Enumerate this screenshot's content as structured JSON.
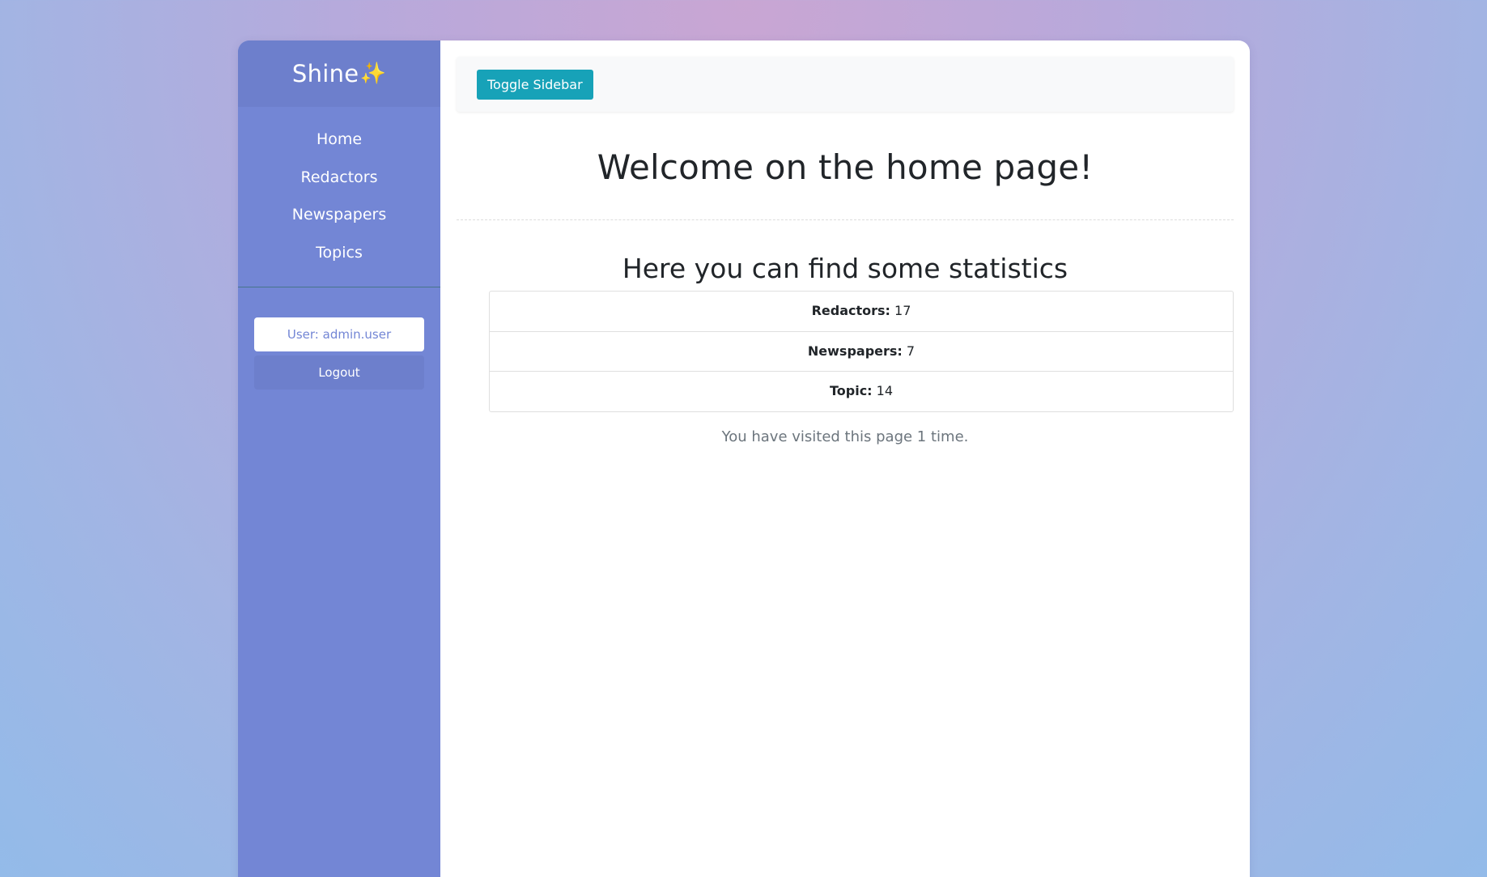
{
  "brand": {
    "name": "Shine",
    "emoji": "✨"
  },
  "sidebar": {
    "items": [
      {
        "label": "Home"
      },
      {
        "label": "Redactors"
      },
      {
        "label": "Newspapers"
      },
      {
        "label": "Topics"
      }
    ],
    "user_label": "User: admin.user",
    "logout_label": "Logout"
  },
  "topbar": {
    "toggle_label": "Toggle Sidebar"
  },
  "main": {
    "welcome": "Welcome on the home page!",
    "stats_title": "Here you can find some statistics",
    "stats": [
      {
        "label": "Redactors:",
        "value": "17"
      },
      {
        "label": "Newspapers:",
        "value": "7"
      },
      {
        "label": "Topic:",
        "value": "14"
      }
    ],
    "visits_text": "You have visited this page 1 time."
  },
  "colors": {
    "sidebar": "#7386d5",
    "sidebar_header": "#6d7fcc",
    "toggle_button": "#17a2b8"
  }
}
